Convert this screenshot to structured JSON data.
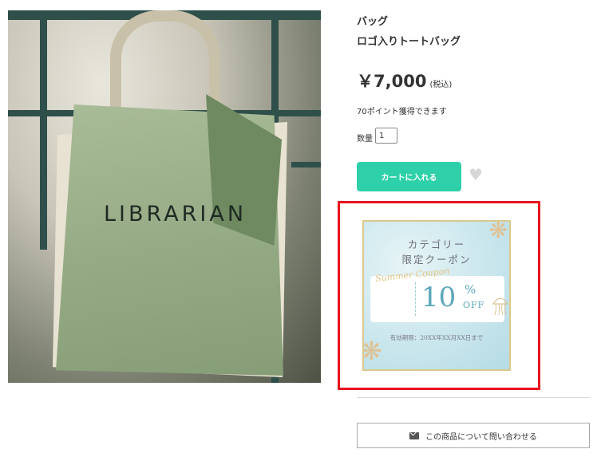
{
  "product": {
    "category": "バッグ",
    "name": "ロゴ入りトートバッグ",
    "price": "￥7,000",
    "price_tax_note": "(税込)",
    "points_note": "70ポイント獲得できます",
    "quantity_label": "数量",
    "quantity_value": "1",
    "image_logo_text": "LIBRARIAN"
  },
  "actions": {
    "add_to_cart": "カートに入れる",
    "favorite_icon": "heart-icon",
    "inquiry": "この商品について問い合わせる",
    "inquiry_icon": "mail-icon"
  },
  "coupon": {
    "title_line1": "カテゴリー",
    "title_line2": "限定クーポン",
    "script_text": "Summer Coupon",
    "discount_number": "10",
    "discount_percent_sign": "%",
    "discount_off": "OFF",
    "expiry": "有効期限：20XX年XX月XX日まで",
    "highlight_color": "#e8141f",
    "accent_color": "#5ba6ba"
  },
  "colors": {
    "cart_button": "#2dd0a8",
    "heart": "#d7d7d7"
  }
}
